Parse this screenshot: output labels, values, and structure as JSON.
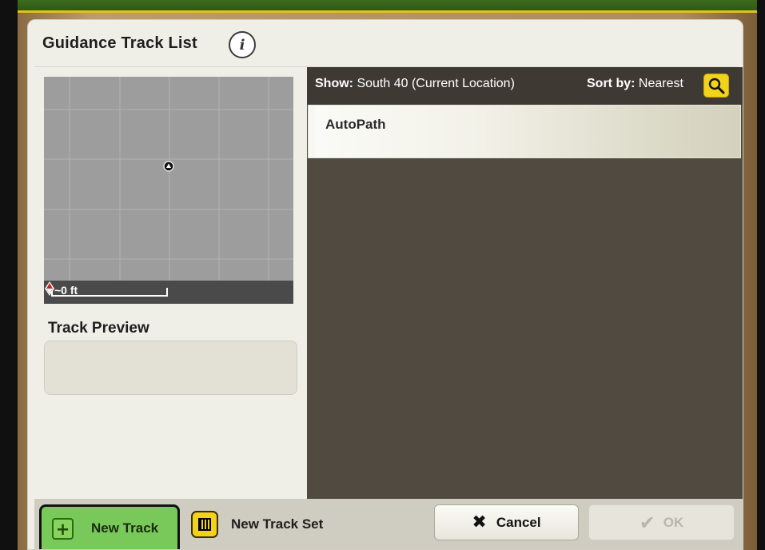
{
  "dialog": {
    "title": "Guidance Track List",
    "info_icon": "info-icon"
  },
  "map": {
    "scale_label": "~0 ft",
    "north_icon": "compass-north-icon",
    "location_icon": "vehicle-location-icon"
  },
  "track_preview": {
    "label": "Track Preview"
  },
  "list": {
    "show_label": "Show:",
    "show_value": "South 40 (Current Location)",
    "sort_label": "Sort by:",
    "sort_value": "Nearest",
    "search_icon": "search-icon",
    "items": [
      {
        "label": "AutoPath"
      }
    ]
  },
  "footer": {
    "new_track_label": "New Track",
    "new_track_icon": "plus-icon",
    "new_track_set_label": "New Track Set",
    "new_track_set_icon": "track-set-icon",
    "cancel_label": "Cancel",
    "cancel_icon": "close-icon",
    "ok_label": "OK",
    "ok_icon": "checkmark-icon"
  },
  "colors": {
    "header_green": "#3c6b1d",
    "accent_yellow": "#f2d21a",
    "list_bg": "#504a41",
    "new_track_green": "#78c85a"
  }
}
